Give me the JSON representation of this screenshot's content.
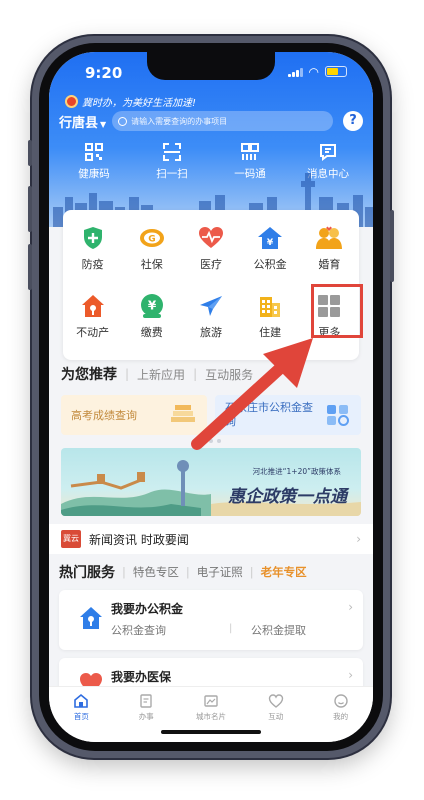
{
  "status_bar": {
    "time": "9:20"
  },
  "header": {
    "slogan": "冀时办，为美好生活加速!",
    "county": "行唐县",
    "search_placeholder": "请输入需要查询的办事项目",
    "quick_actions": [
      {
        "label": "健康码",
        "icon": "qr-grid-icon"
      },
      {
        "label": "扫一扫",
        "icon": "scan-icon"
      },
      {
        "label": "一码通",
        "icon": "barcode-icon"
      },
      {
        "label": "消息中心",
        "icon": "message-icon"
      }
    ]
  },
  "service_grid": {
    "row1": [
      {
        "label": "防疫",
        "icon": "shield-plus-icon",
        "color": "#2fb36d"
      },
      {
        "label": "社保",
        "icon": "social-security-icon",
        "color": "#f2a31a"
      },
      {
        "label": "医疗",
        "icon": "heart-pulse-icon",
        "color": "#ec5a4a"
      },
      {
        "label": "公积金",
        "icon": "house-fund-icon",
        "color": "#2f7ee8"
      },
      {
        "label": "婚育",
        "icon": "couple-icon",
        "color": "#f2a31a"
      }
    ],
    "row2": [
      {
        "label": "不动产",
        "icon": "property-icon",
        "color": "#ec5a2a"
      },
      {
        "label": "缴费",
        "icon": "payment-icon",
        "color": "#2fb36d"
      },
      {
        "label": "旅游",
        "icon": "plane-icon",
        "color": "#2f7ee8"
      },
      {
        "label": "住建",
        "icon": "building-icon",
        "color": "#f2b21a"
      },
      {
        "label": "更多",
        "icon": "more-grid-icon",
        "color": "#9a9a9a"
      }
    ]
  },
  "recommend": {
    "tabs": [
      "为您推荐",
      "上新应用",
      "互动服务"
    ],
    "cards": [
      "高考成绩查询",
      "石家庄市公积金查询"
    ]
  },
  "banner": {
    "subtitle": "河北推进“1+20”政策体系",
    "title": "惠企政策一点通"
  },
  "news": {
    "badge": "冀云",
    "text": "新闻资讯 时政要闻"
  },
  "hot_services": {
    "tabs": [
      "热门服务",
      "特色专区",
      "电子证照",
      "老年专区"
    ],
    "items": [
      {
        "title": "我要办公积金",
        "links": [
          "公积金查询",
          "公积金提取"
        ]
      },
      {
        "title": "我要办医保"
      }
    ]
  },
  "tabbar": [
    "首页",
    "办事",
    "城市名片",
    "互动",
    "我的"
  ],
  "colors": {
    "primary": "#1f6ff2",
    "highlight": "#e0453a"
  }
}
